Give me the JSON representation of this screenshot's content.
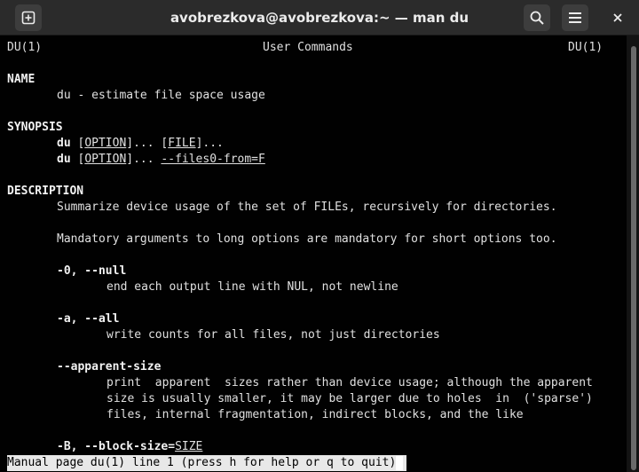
{
  "window": {
    "title": "avobrezkova@avobrezkova:~ — man du",
    "icons": {
      "new_tab": "plus-square-icon",
      "search": "search-icon",
      "menu": "hamburger-menu-icon",
      "close": "close-icon"
    }
  },
  "man": {
    "header_left": "DU(1)",
    "header_center": "User Commands",
    "header_right": "DU(1)",
    "name_heading": "NAME",
    "name_text": "du - estimate file space usage",
    "synopsis_heading": "SYNOPSIS",
    "syn1": {
      "cmd": "du",
      "opt": "OPTION",
      "rest": "... ",
      "file": "FILE",
      "end": "..."
    },
    "syn2": {
      "cmd": "du",
      "opt": "OPTION",
      "rest": "... ",
      "files0": "--files0-from=F"
    },
    "description_heading": "DESCRIPTION",
    "desc1": "Summarize device usage of the set of FILEs, recursively for directories.",
    "desc2": "Mandatory arguments to long options are mandatory for short options too.",
    "opt_null": "-0, --null",
    "opt_null_desc": "end each output line with NUL, not newline",
    "opt_all": "-a, --all",
    "opt_all_desc": "write counts for all files, not just directories",
    "opt_apparent": "--apparent-size",
    "opt_apparent_desc1": "print  apparent  sizes rather than device usage; although the apparent",
    "opt_apparent_desc2": "size is usually smaller, it may be larger due to holes  in  ('sparse')",
    "opt_apparent_desc3": "files, internal fragmentation, indirect blocks, and the like",
    "opt_block": "-B, --block-size=",
    "opt_block_arg": "SIZE"
  },
  "status_line": "Manual page du(1) line 1 (press h for help or q to quit)",
  "colors": {
    "titlebar": "#2b2b2b",
    "terminal_bg": "#010101",
    "text": "#e0e0e0",
    "status_bg": "#e8e8e8"
  }
}
